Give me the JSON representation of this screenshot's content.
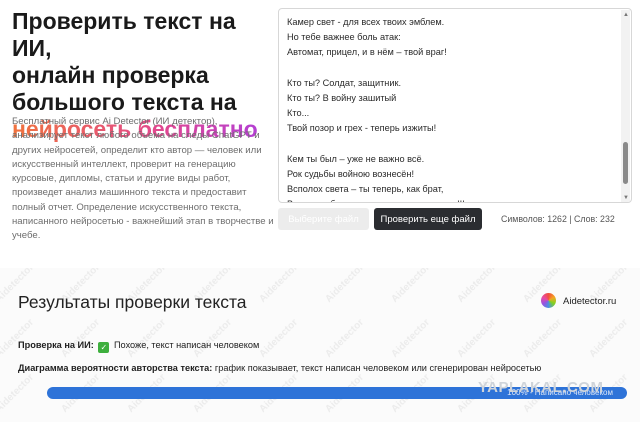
{
  "hero": {
    "title_l1": "Проверить текст на ИИ,",
    "title_l2": "онлайн проверка",
    "title_l3": "большого текста на",
    "title_highlight": "нейросеть бесплатно",
    "description": "Бесплатный сервис Ai Detector (ИИ детектор), анализирует текст любого объема на следы ChatGPT и других нейросетей, определит кто автор — человек или искусственный интеллект, проверит на генерацию курсовые, дипломы, статьи и другие виды работ, произведет анализ машинного текста и предоставит полный отчет. Определение искусственного текста, написанного нейросетью - важнейший этап в творчестве и учебе.",
    "gradient_colors": [
      "#f0733d",
      "#e2478f",
      "#b43fd3"
    ]
  },
  "editor": {
    "text": "Камер свет - для всех твоих эмблем.\nНо тебе важнее боль атак:\nАвтомат, прицел, и в нём – твой враг!\n\nКто ты? Солдат, защитник.\nКто ты? В войну зашитый\nКто...\nТвой позор и грех - теперь изжиты!\n\nКем ты был – уже не важно всё.\nРок судьбы войною вознесён!\nВсполох света – ты теперь, как брат,\nВсем, кто был врагом – лишь миг назад!!!"
  },
  "actions": {
    "choose_file": "Выберите файл",
    "check_another": "Проверить еще файл",
    "counter": "Символов: 1262 | Слов: 232"
  },
  "results": {
    "title": "Результаты проверки текста",
    "brand": "Aidetector.ru",
    "ai_check_label": "Проверка на ИИ:",
    "ai_check_value": "Похоже, текст написан человеком",
    "chart_label": "Диаграмма вероятности авторства текста:",
    "chart_desc": "график показывает, текст написан человеком или сгенерирован нейросетью",
    "bar_label_human": "Написано человеком",
    "bar_label_percent": "100%",
    "human_fraction": 1.0,
    "bar_color": "#2e73d8",
    "watermark": "Aidetector",
    "yaplakal": "YAPLAKAL.COM"
  }
}
